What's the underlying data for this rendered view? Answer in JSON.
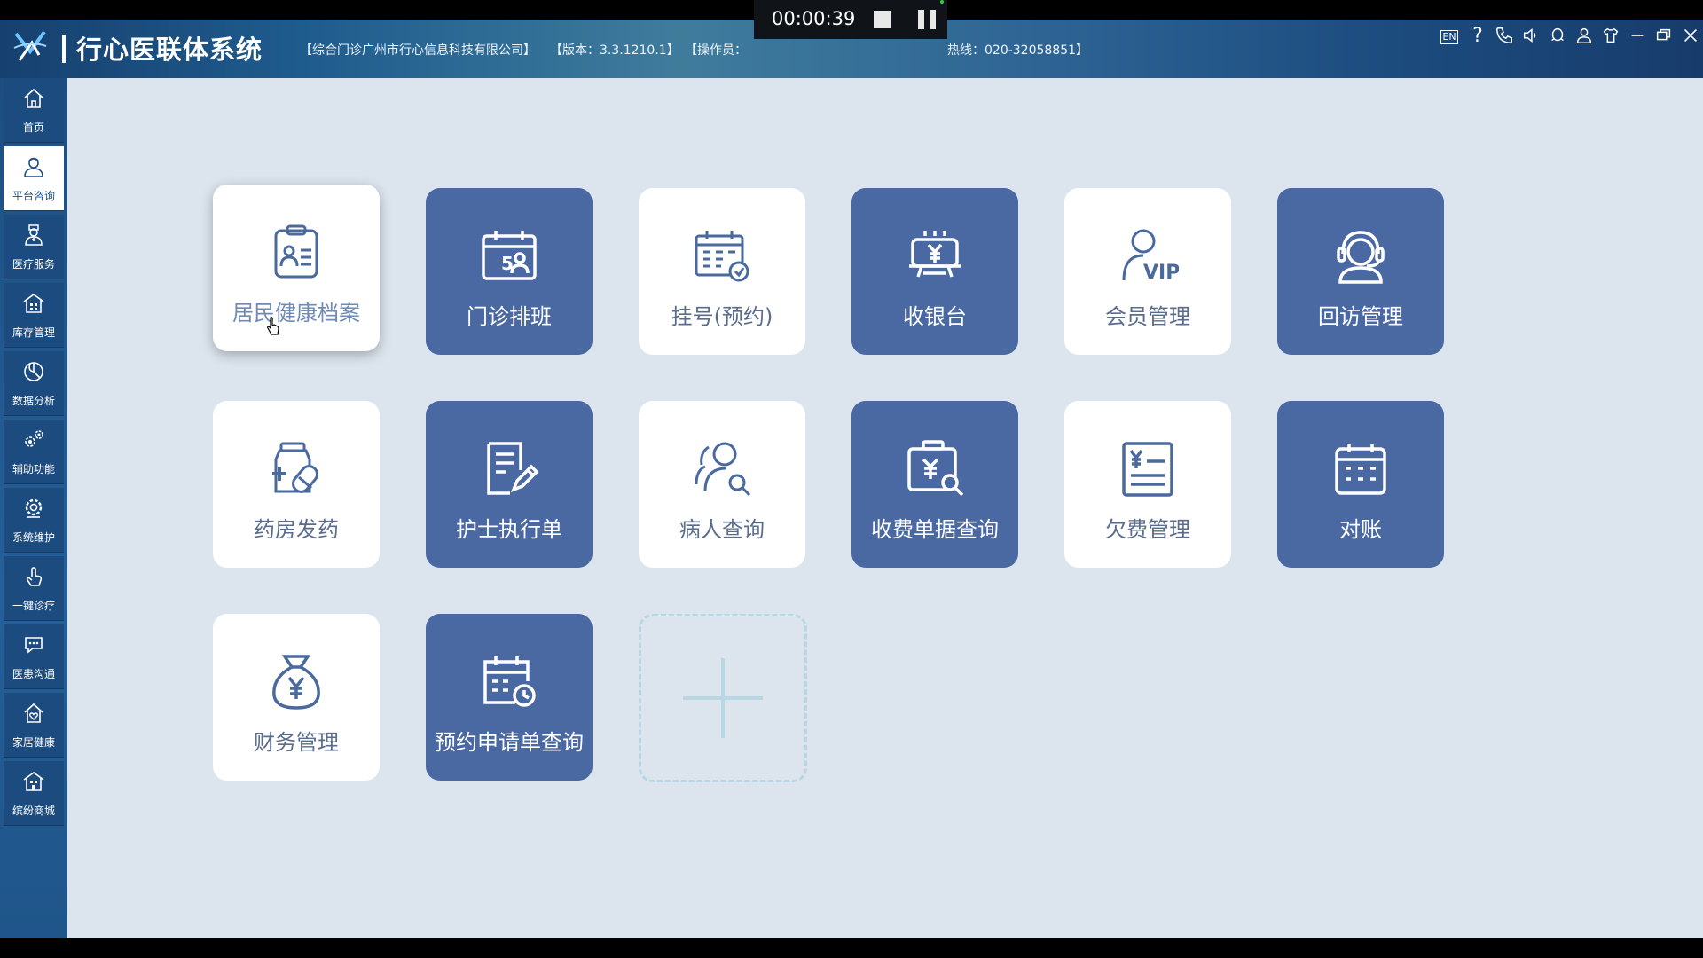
{
  "header": {
    "app_title": "行心医联体系统",
    "clinic": "【综合门诊广州市行心信息科技有限公司】",
    "version": "【版本：3.3.1210.1】",
    "operator": "【操作员：",
    "hotline": "热线：020-32058851】"
  },
  "recorder": {
    "time": "00:00:39"
  },
  "window_controls": {
    "lang": "EN",
    "help": "?"
  },
  "sidebar": {
    "items": [
      {
        "label": "首页",
        "icon": "home-icon"
      },
      {
        "label": "平台咨询",
        "icon": "nurse-icon"
      },
      {
        "label": "医疗服务",
        "icon": "doctor-icon"
      },
      {
        "label": "库存管理",
        "icon": "warehouse-icon"
      },
      {
        "label": "数据分析",
        "icon": "pie-chart-icon"
      },
      {
        "label": "辅助功能",
        "icon": "gears-icon"
      },
      {
        "label": "系统维护",
        "icon": "gear-icon"
      },
      {
        "label": "一键诊疗",
        "icon": "tap-icon"
      },
      {
        "label": "医患沟通",
        "icon": "chat-icon"
      },
      {
        "label": "家居健康",
        "icon": "home-heart-icon"
      },
      {
        "label": "缤纷商城",
        "icon": "store-icon"
      }
    ],
    "active_index": 1
  },
  "tiles": [
    {
      "label": "居民健康档案",
      "icon": "health-record-icon",
      "theme": "light"
    },
    {
      "label": "门诊排班",
      "icon": "schedule-calendar-icon",
      "theme": "dark"
    },
    {
      "label": "挂号(预约)",
      "icon": "registration-calendar-icon",
      "theme": "light"
    },
    {
      "label": "收银台",
      "icon": "cashier-icon",
      "theme": "dark"
    },
    {
      "label": "会员管理",
      "icon": "vip-member-icon",
      "theme": "light"
    },
    {
      "label": "回访管理",
      "icon": "headset-icon",
      "theme": "dark"
    },
    {
      "label": "药房发药",
      "icon": "pharmacy-icon",
      "theme": "light"
    },
    {
      "label": "护士执行单",
      "icon": "nurse-order-icon",
      "theme": "dark"
    },
    {
      "label": "病人查询",
      "icon": "patient-search-icon",
      "theme": "light"
    },
    {
      "label": "收费单据查询",
      "icon": "receipt-search-icon",
      "theme": "dark"
    },
    {
      "label": "欠费管理",
      "icon": "arrears-icon",
      "theme": "light"
    },
    {
      "label": "对账",
      "icon": "reconcile-calendar-icon",
      "theme": "dark"
    },
    {
      "label": "财务管理",
      "icon": "money-bag-icon",
      "theme": "light"
    },
    {
      "label": "预约申请单查询",
      "icon": "appointment-query-icon",
      "theme": "dark"
    }
  ],
  "colors": {
    "tile_dark": "#4a69a2",
    "tile_light": "#ffffff",
    "workspace": "#dce4ee",
    "sidebar": "#1c4b80"
  }
}
